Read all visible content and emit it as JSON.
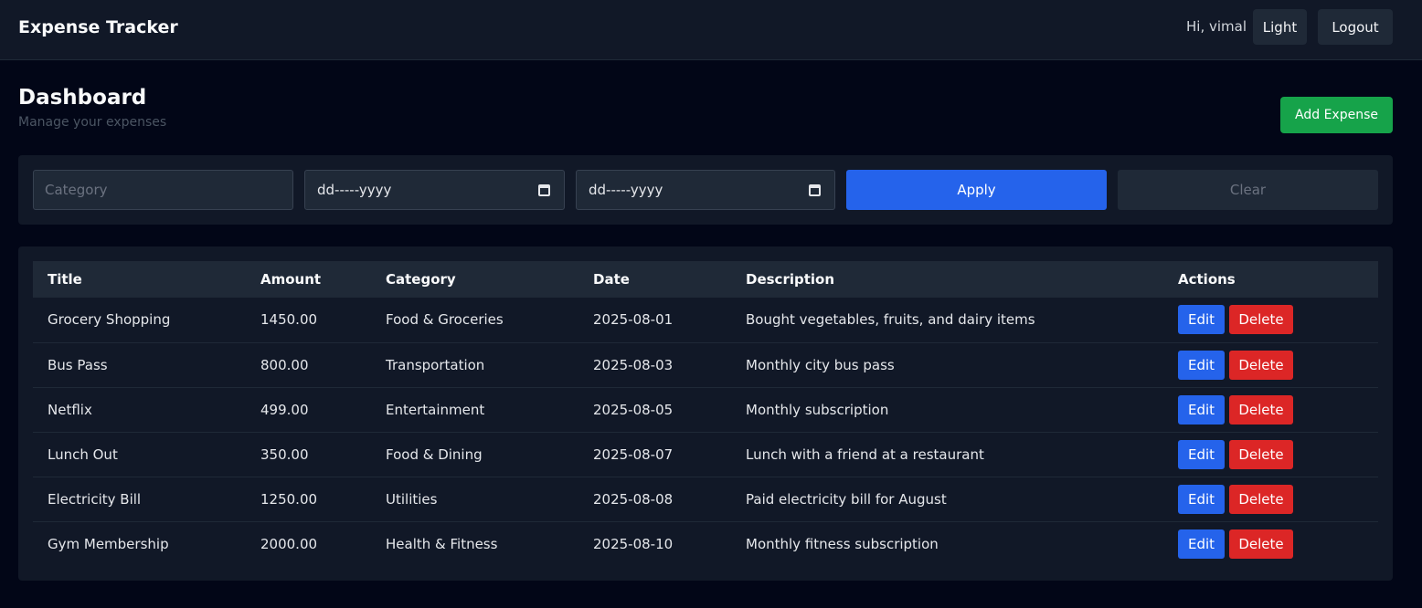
{
  "header": {
    "brand": "Expense Tracker",
    "greeting": "Hi, vimal",
    "theme_toggle_label": "Light",
    "logout_label": "Logout"
  },
  "page": {
    "title": "Dashboard",
    "subtitle": "Manage your expenses",
    "add_button_label": "Add Expense"
  },
  "filters": {
    "category_placeholder": "Category",
    "date_from_value": "dd-----yyyy",
    "date_to_value": "dd-----yyyy",
    "apply_label": "Apply",
    "clear_label": "Clear"
  },
  "table": {
    "columns": [
      "Title",
      "Amount",
      "Category",
      "Date",
      "Description",
      "Actions"
    ],
    "edit_label": "Edit",
    "delete_label": "Delete",
    "rows": [
      {
        "title": "Grocery Shopping",
        "amount": "1450.00",
        "category": "Food & Groceries",
        "date": "2025-08-01",
        "description": "Bought vegetables, fruits, and dairy items"
      },
      {
        "title": "Bus Pass",
        "amount": "800.00",
        "category": "Transportation",
        "date": "2025-08-03",
        "description": "Monthly city bus pass"
      },
      {
        "title": "Netflix",
        "amount": "499.00",
        "category": "Entertainment",
        "date": "2025-08-05",
        "description": "Monthly subscription"
      },
      {
        "title": "Lunch Out",
        "amount": "350.00",
        "category": "Food & Dining",
        "date": "2025-08-07",
        "description": "Lunch with a friend at a restaurant"
      },
      {
        "title": "Electricity Bill",
        "amount": "1250.00",
        "category": "Utilities",
        "date": "2025-08-08",
        "description": "Paid electricity bill for August"
      },
      {
        "title": "Gym Membership",
        "amount": "2000.00",
        "category": "Health & Fitness",
        "date": "2025-08-10",
        "description": "Monthly fitness subscription"
      }
    ]
  },
  "colors": {
    "background": "#020617",
    "surface": "#111827",
    "accent_blue": "#2563eb",
    "success_green": "#16a34a",
    "danger_red": "#dc2626"
  },
  "icons": {
    "date_picker": "calendar-icon"
  }
}
